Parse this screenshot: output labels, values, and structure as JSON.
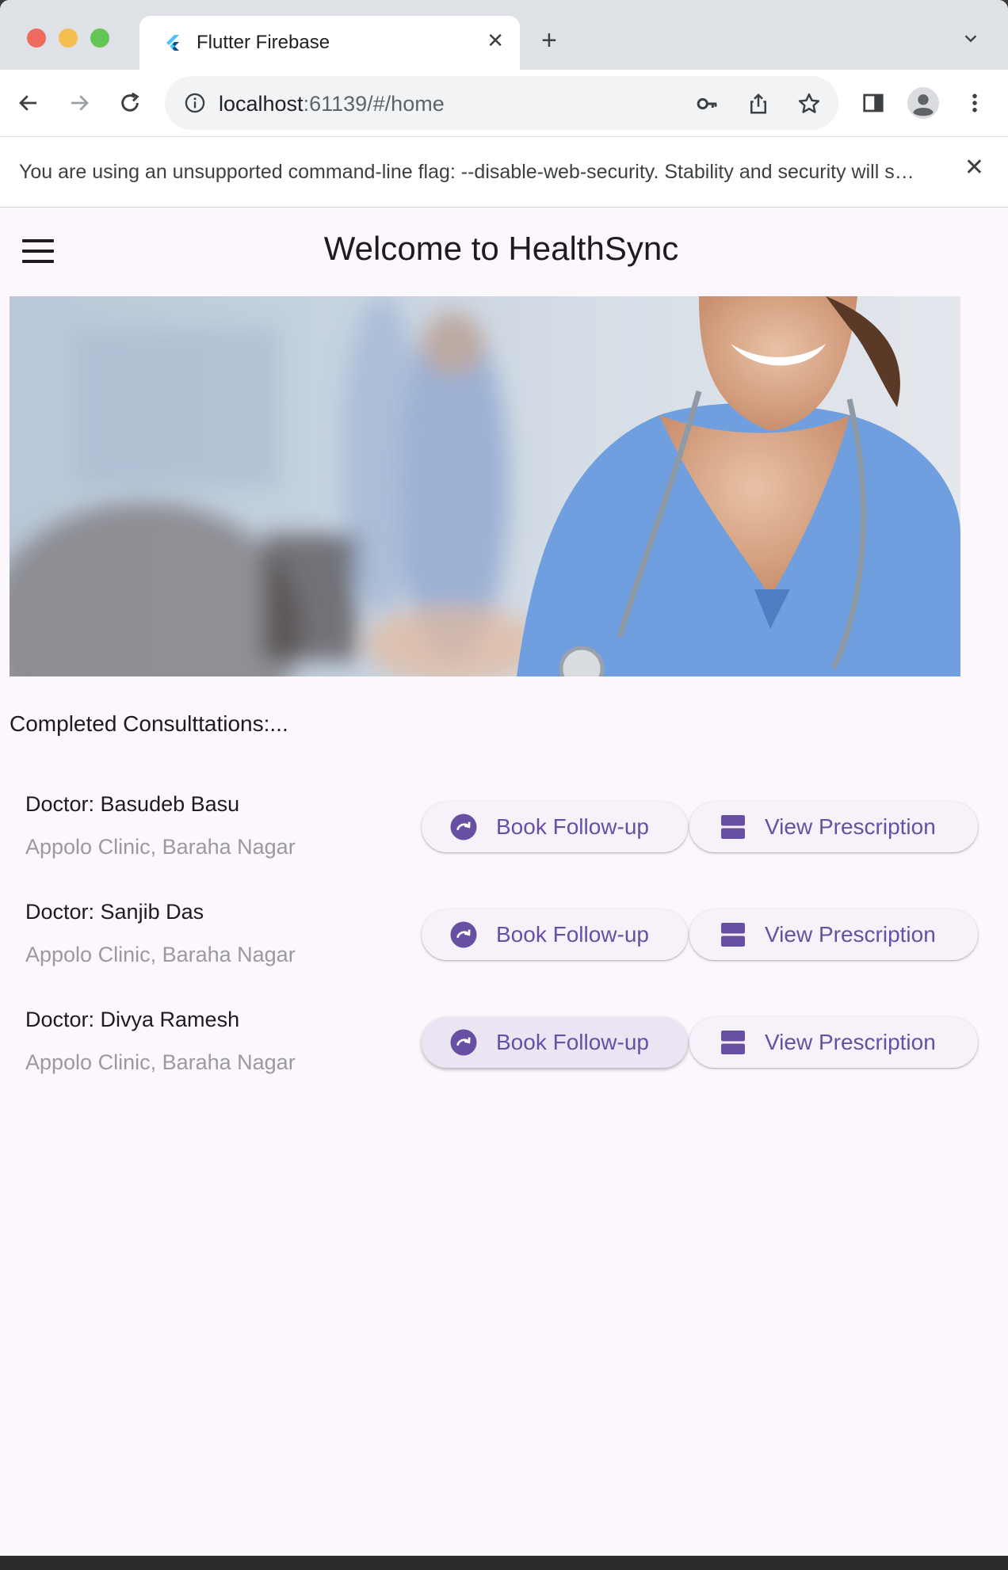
{
  "browser": {
    "tab_title": "Flutter Firebase",
    "tab_close": "✕",
    "new_tab": "+",
    "url_host": "localhost",
    "url_path": ":61139/#/home",
    "infobar_text": "You are using an unsupported command-line flag: --disable-web-security. Stability and security will suffer.",
    "infobar_close": "✕"
  },
  "app": {
    "title": "Welcome to HealthSync",
    "section_title": "Completed Consulttations:...",
    "consultations": [
      {
        "doctor": "Doctor: Basudeb Basu",
        "clinic": "Appolo Clinic, Baraha Nagar",
        "follow_label": "Book Follow-up",
        "prescription_label": "View Prescription"
      },
      {
        "doctor": "Doctor: Sanjib Das",
        "clinic": "Appolo Clinic, Baraha Nagar",
        "follow_label": "Book Follow-up",
        "prescription_label": "View Prescription"
      },
      {
        "doctor": "Doctor: Divya Ramesh",
        "clinic": "Appolo Clinic, Baraha Nagar",
        "follow_label": "Book Follow-up",
        "prescription_label": "View Prescription"
      }
    ]
  },
  "colors": {
    "accent": "#6750a4",
    "background": "#fcf6fd",
    "button_bg": "#f7f1fa"
  },
  "icons": {
    "menu": "hamburger-menu-icon",
    "follow": "redo-circle-icon",
    "prescription": "view-agenda-icon"
  }
}
